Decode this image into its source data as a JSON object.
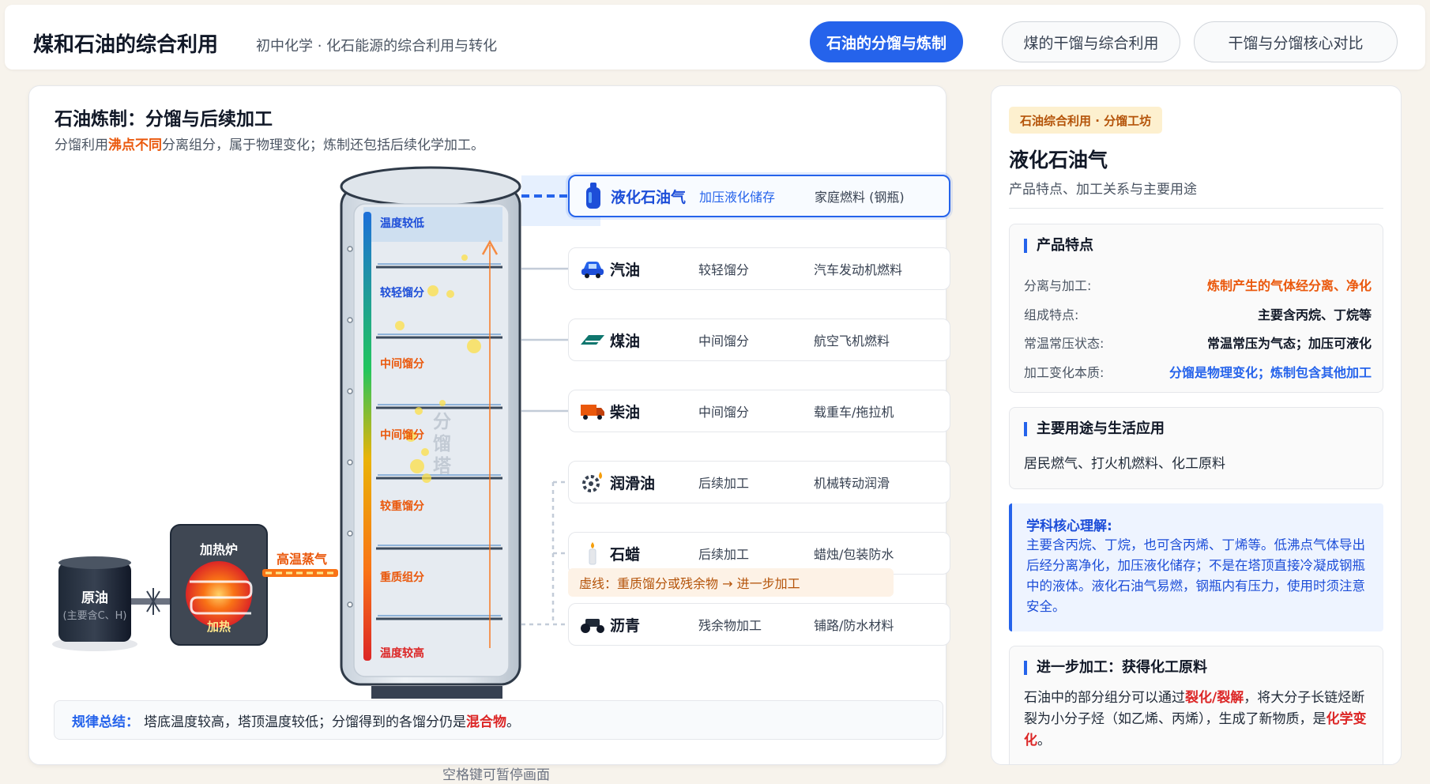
{
  "header": {
    "title": "煤和石油的综合利用",
    "subtitle": "初中化学 · 化石能源的综合利用与转化",
    "tabs": [
      {
        "label": "石油的分馏与炼制",
        "active": true
      },
      {
        "label": "煤的干馏与综合利用",
        "active": false
      },
      {
        "label": "干馏与分馏核心对比",
        "active": false
      }
    ]
  },
  "main": {
    "title": "石油炼制：分馏与后续加工",
    "desc_pre": "分馏利用",
    "desc_highlight": "沸点不同",
    "desc_post": "分离组分，属于物理变化；炼制还包括后续化学加工。",
    "crude": {
      "label": "原油",
      "sub": "(主要含C、H)"
    },
    "furnace": {
      "label": "加热炉",
      "heat": "加热"
    },
    "vapor_label": "高温蒸气",
    "tower_label": "分馏塔",
    "tower_levels": [
      "温度较低",
      "较轻馏分",
      "中间馏分",
      "中间馏分",
      "较重馏分",
      "重质组分",
      "温度较高"
    ],
    "products": [
      {
        "name": "液化石油气",
        "tag": "加压液化储存",
        "use": "家庭燃料 (钢瓶)",
        "icon": "gas-cylinder-icon",
        "active": true
      },
      {
        "name": "汽油",
        "tag": "较轻馏分",
        "use": "汽车发动机燃料",
        "icon": "car-icon",
        "active": false
      },
      {
        "name": "煤油",
        "tag": "中间馏分",
        "use": "航空飞机燃料",
        "icon": "airplane-icon",
        "active": false
      },
      {
        "name": "柴油",
        "tag": "中间馏分",
        "use": "载重车/拖拉机",
        "icon": "truck-icon",
        "active": false
      },
      {
        "name": "润滑油",
        "tag": "后续加工",
        "use": "机械转动润滑",
        "icon": "gear-oil-icon",
        "active": false
      },
      {
        "name": "石蜡",
        "tag": "后续加工",
        "use": "蜡烛/包装防水",
        "icon": "candle-icon",
        "active": false
      },
      {
        "name": "沥青",
        "tag": "残余物加工",
        "use": "铺路/防水材料",
        "icon": "road-roller-icon",
        "active": false
      }
    ],
    "legend_note": "虚线：重质馏分或残余物 → 进一步加工",
    "summary": {
      "label": "规律总结：",
      "text_pre": "塔底温度较高，塔顶温度较低；分馏得到的各馏分仍是",
      "highlight": "混合物",
      "text_post": "。"
    },
    "pause_hint": "空格键可暂停画面"
  },
  "detail": {
    "badge": "石油综合利用 · 分馏工坊",
    "title": "液化石油气",
    "subtitle": "产品特点、加工关系与主要用途",
    "features": {
      "title": "产品特点",
      "rows": [
        {
          "key": "分离与加工:",
          "value": "炼制产生的气体经分离、净化",
          "color": "orange"
        },
        {
          "key": "组成特点:",
          "value": "主要含丙烷、丁烷等",
          "color": "default"
        },
        {
          "key": "常温常压状态:",
          "value": "常温常压为气态；加压可液化",
          "color": "default"
        },
        {
          "key": "加工变化本质:",
          "value": "分馏是物理变化；炼制包含其他加工",
          "color": "blue"
        }
      ]
    },
    "uses": {
      "title": "主要用途与生活应用",
      "text": "居民燃气、打火机燃料、化工原料"
    },
    "insight": {
      "title": "学科核心理解:",
      "text": "主要含丙烷、丁烷，也可含丙烯、丁烯等。低沸点气体导出后经分离净化，加压液化储存；不是在塔顶直接冷凝成钢瓶中的液体。液化石油气易燃，钢瓶内有压力，使用时须注意安全。"
    },
    "further": {
      "title": "进一步加工：获得化工原料",
      "text_pre": "石油中的部分组分可以通过",
      "highlight1": "裂化/裂解",
      "text_mid": "，将大分子长链烃断裂为小分子烃（如乙烯、丙烯），生成了新物质，是",
      "highlight2": "化学变化",
      "text_post": "。"
    }
  }
}
